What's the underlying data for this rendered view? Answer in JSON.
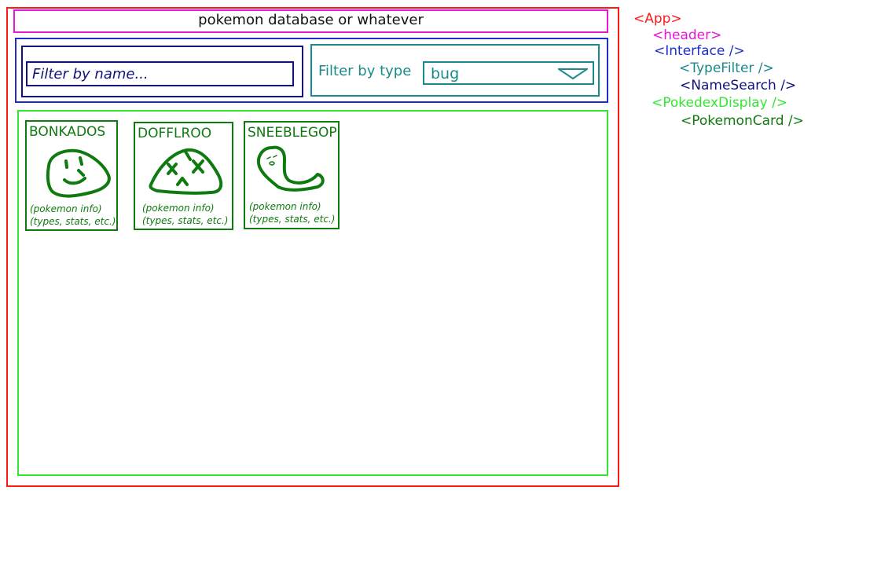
{
  "header": {
    "title": "pokemon database or whatever"
  },
  "name_search": {
    "placeholder": "Filter by name..."
  },
  "type_filter": {
    "label": "Filter by type",
    "selected": "bug"
  },
  "cards": [
    {
      "name": "BONKADOS",
      "info_line1": "(pokemon info)",
      "info_line2": "(types, stats, etc.)"
    },
    {
      "name": "DOFFLROO",
      "info_line1": "(pokemon info)",
      "info_line2": "(types, stats, etc.)"
    },
    {
      "name": "SNEEBLEGOP",
      "info_line1": "(pokemon info)",
      "info_line2": "(types, stats, etc.)"
    }
  ],
  "component_tree": [
    {
      "text": "<App>",
      "color": "#ff1a1a"
    },
    {
      "text": "<header>",
      "color": "#e617d6"
    },
    {
      "text": "<Interface />",
      "color": "#1f2dcc"
    },
    {
      "text": "<TypeFilter />",
      "color": "#1a8a8a"
    },
    {
      "text": "<NameSearch />",
      "color": "#12127a"
    },
    {
      "text": "<PokedexDisplay />",
      "color": "#33e633"
    },
    {
      "text": "<PokemonCard />",
      "color": "#0f7a0f"
    }
  ],
  "colors": {
    "app": "#ff1a1a",
    "header": "#e617d6",
    "interface": "#1f2dcc",
    "type_filter": "#1a8a8a",
    "name_search": "#12127a",
    "pokedex_display": "#33e633",
    "pokemon_card": "#0f7a0f"
  }
}
